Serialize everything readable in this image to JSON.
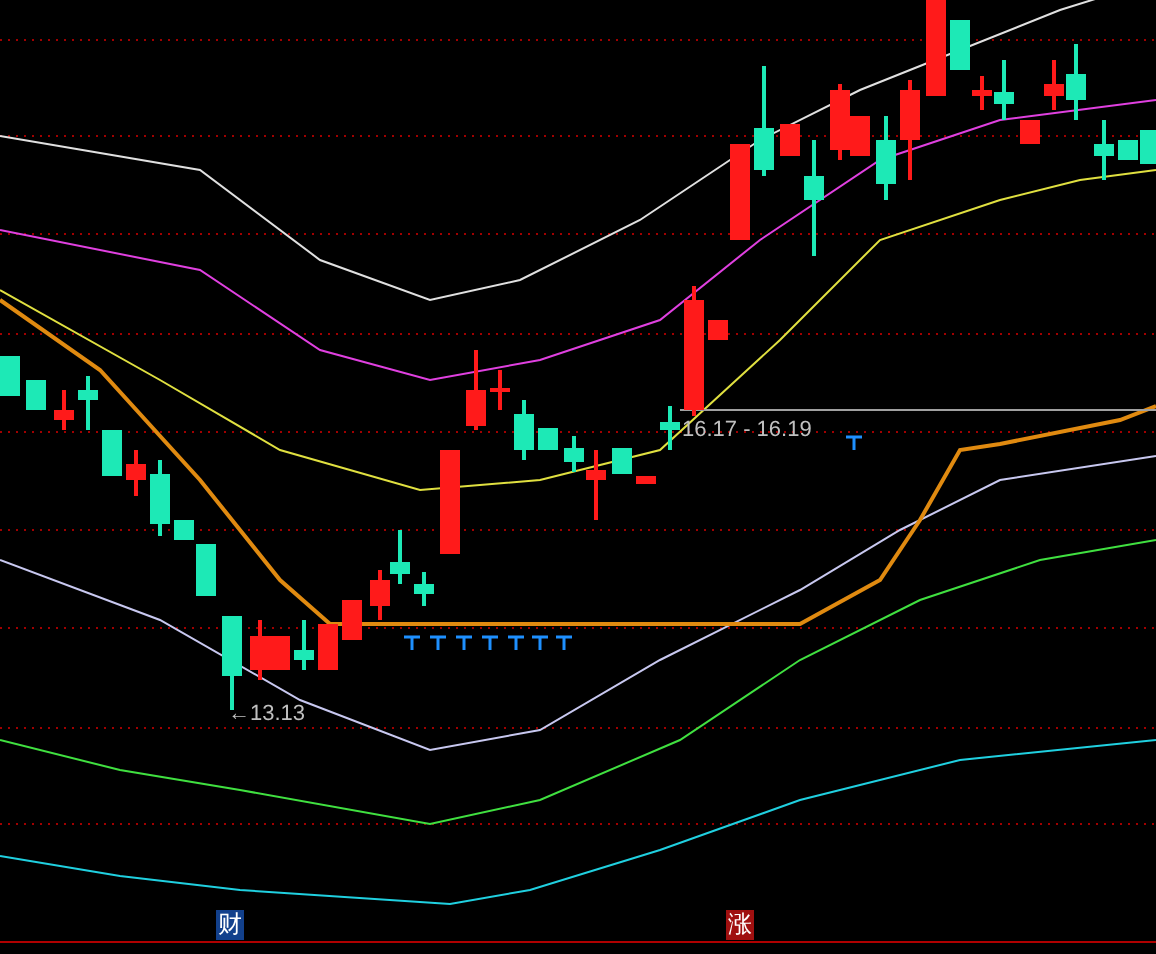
{
  "chart_labels": [
    {
      "kind": "range",
      "text": "16.17 - 16.19"
    },
    {
      "kind": "low",
      "text": "←13.13"
    }
  ],
  "footer_badges": [
    {
      "text": "财",
      "color": "#12408c"
    },
    {
      "text": "涨",
      "color": "#a01010"
    }
  ]
}
